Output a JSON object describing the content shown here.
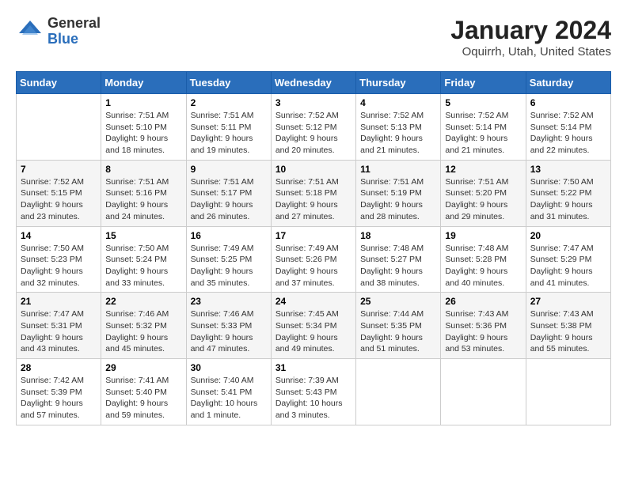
{
  "logo": {
    "general": "General",
    "blue": "Blue"
  },
  "title": {
    "month_year": "January 2024",
    "location": "Oquirrh, Utah, United States"
  },
  "weekdays": [
    "Sunday",
    "Monday",
    "Tuesday",
    "Wednesday",
    "Thursday",
    "Friday",
    "Saturday"
  ],
  "weeks": [
    [
      {
        "day": "",
        "info": ""
      },
      {
        "day": "1",
        "info": "Sunrise: 7:51 AM\nSunset: 5:10 PM\nDaylight: 9 hours\nand 18 minutes."
      },
      {
        "day": "2",
        "info": "Sunrise: 7:51 AM\nSunset: 5:11 PM\nDaylight: 9 hours\nand 19 minutes."
      },
      {
        "day": "3",
        "info": "Sunrise: 7:52 AM\nSunset: 5:12 PM\nDaylight: 9 hours\nand 20 minutes."
      },
      {
        "day": "4",
        "info": "Sunrise: 7:52 AM\nSunset: 5:13 PM\nDaylight: 9 hours\nand 21 minutes."
      },
      {
        "day": "5",
        "info": "Sunrise: 7:52 AM\nSunset: 5:14 PM\nDaylight: 9 hours\nand 21 minutes."
      },
      {
        "day": "6",
        "info": "Sunrise: 7:52 AM\nSunset: 5:14 PM\nDaylight: 9 hours\nand 22 minutes."
      }
    ],
    [
      {
        "day": "7",
        "info": "Sunrise: 7:52 AM\nSunset: 5:15 PM\nDaylight: 9 hours\nand 23 minutes."
      },
      {
        "day": "8",
        "info": "Sunrise: 7:51 AM\nSunset: 5:16 PM\nDaylight: 9 hours\nand 24 minutes."
      },
      {
        "day": "9",
        "info": "Sunrise: 7:51 AM\nSunset: 5:17 PM\nDaylight: 9 hours\nand 26 minutes."
      },
      {
        "day": "10",
        "info": "Sunrise: 7:51 AM\nSunset: 5:18 PM\nDaylight: 9 hours\nand 27 minutes."
      },
      {
        "day": "11",
        "info": "Sunrise: 7:51 AM\nSunset: 5:19 PM\nDaylight: 9 hours\nand 28 minutes."
      },
      {
        "day": "12",
        "info": "Sunrise: 7:51 AM\nSunset: 5:20 PM\nDaylight: 9 hours\nand 29 minutes."
      },
      {
        "day": "13",
        "info": "Sunrise: 7:50 AM\nSunset: 5:22 PM\nDaylight: 9 hours\nand 31 minutes."
      }
    ],
    [
      {
        "day": "14",
        "info": "Sunrise: 7:50 AM\nSunset: 5:23 PM\nDaylight: 9 hours\nand 32 minutes."
      },
      {
        "day": "15",
        "info": "Sunrise: 7:50 AM\nSunset: 5:24 PM\nDaylight: 9 hours\nand 33 minutes."
      },
      {
        "day": "16",
        "info": "Sunrise: 7:49 AM\nSunset: 5:25 PM\nDaylight: 9 hours\nand 35 minutes."
      },
      {
        "day": "17",
        "info": "Sunrise: 7:49 AM\nSunset: 5:26 PM\nDaylight: 9 hours\nand 37 minutes."
      },
      {
        "day": "18",
        "info": "Sunrise: 7:48 AM\nSunset: 5:27 PM\nDaylight: 9 hours\nand 38 minutes."
      },
      {
        "day": "19",
        "info": "Sunrise: 7:48 AM\nSunset: 5:28 PM\nDaylight: 9 hours\nand 40 minutes."
      },
      {
        "day": "20",
        "info": "Sunrise: 7:47 AM\nSunset: 5:29 PM\nDaylight: 9 hours\nand 41 minutes."
      }
    ],
    [
      {
        "day": "21",
        "info": "Sunrise: 7:47 AM\nSunset: 5:31 PM\nDaylight: 9 hours\nand 43 minutes."
      },
      {
        "day": "22",
        "info": "Sunrise: 7:46 AM\nSunset: 5:32 PM\nDaylight: 9 hours\nand 45 minutes."
      },
      {
        "day": "23",
        "info": "Sunrise: 7:46 AM\nSunset: 5:33 PM\nDaylight: 9 hours\nand 47 minutes."
      },
      {
        "day": "24",
        "info": "Sunrise: 7:45 AM\nSunset: 5:34 PM\nDaylight: 9 hours\nand 49 minutes."
      },
      {
        "day": "25",
        "info": "Sunrise: 7:44 AM\nSunset: 5:35 PM\nDaylight: 9 hours\nand 51 minutes."
      },
      {
        "day": "26",
        "info": "Sunrise: 7:43 AM\nSunset: 5:36 PM\nDaylight: 9 hours\nand 53 minutes."
      },
      {
        "day": "27",
        "info": "Sunrise: 7:43 AM\nSunset: 5:38 PM\nDaylight: 9 hours\nand 55 minutes."
      }
    ],
    [
      {
        "day": "28",
        "info": "Sunrise: 7:42 AM\nSunset: 5:39 PM\nDaylight: 9 hours\nand 57 minutes."
      },
      {
        "day": "29",
        "info": "Sunrise: 7:41 AM\nSunset: 5:40 PM\nDaylight: 9 hours\nand 59 minutes."
      },
      {
        "day": "30",
        "info": "Sunrise: 7:40 AM\nSunset: 5:41 PM\nDaylight: 10 hours\nand 1 minute."
      },
      {
        "day": "31",
        "info": "Sunrise: 7:39 AM\nSunset: 5:43 PM\nDaylight: 10 hours\nand 3 minutes."
      },
      {
        "day": "",
        "info": ""
      },
      {
        "day": "",
        "info": ""
      },
      {
        "day": "",
        "info": ""
      }
    ]
  ]
}
